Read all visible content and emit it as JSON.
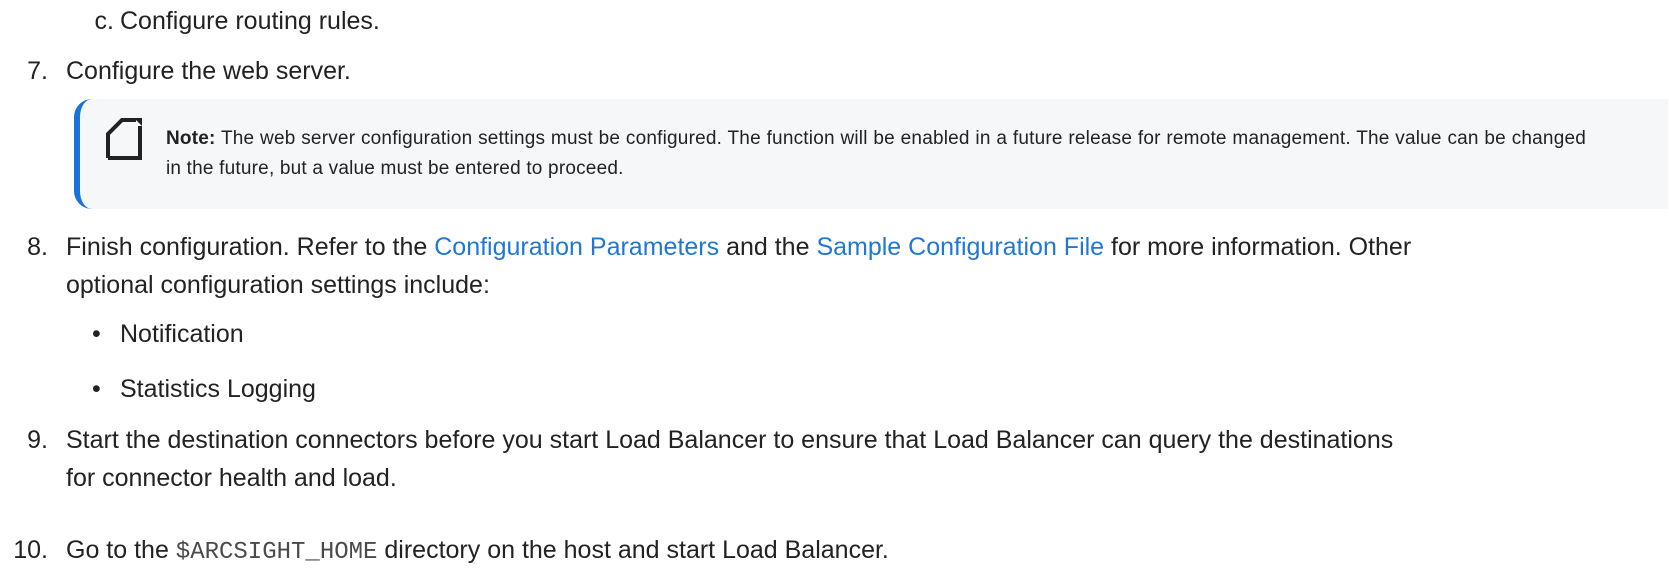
{
  "steps": {
    "c": {
      "marker": "c.",
      "text": "Configure routing rules."
    },
    "s7": {
      "marker": "7.",
      "text": "Configure the web server."
    },
    "note": {
      "label": "Note:",
      "text": " The web server configuration settings must be configured. The function will be enabled in a future release for remote management. The value can be changed in the future, but a value must be entered to proceed."
    },
    "s8": {
      "marker": "8.",
      "part1": "Finish configuration. Refer to the ",
      "link1": "Configuration Parameters",
      "part2": " and the ",
      "link2": "Sample Configuration File",
      "part3": " for more information. Other",
      "line2": "optional configuration settings include:",
      "bullets": [
        "Notification",
        "Statistics Logging"
      ]
    },
    "s9": {
      "marker": "9.",
      "line1": "Start the destination connectors before you start Load Balancer to ensure that Load Balancer can query the destinations",
      "line2": "for connector health and load."
    },
    "s10": {
      "marker": "10.",
      "part1": "Go to the ",
      "code": "$ARCSIGHT_HOME",
      "part2": " directory on the host and start Load Balancer."
    }
  },
  "colors": {
    "link": "#1f78d1",
    "note_border": "#1a73d8",
    "note_bg": "#f6f7f9"
  }
}
